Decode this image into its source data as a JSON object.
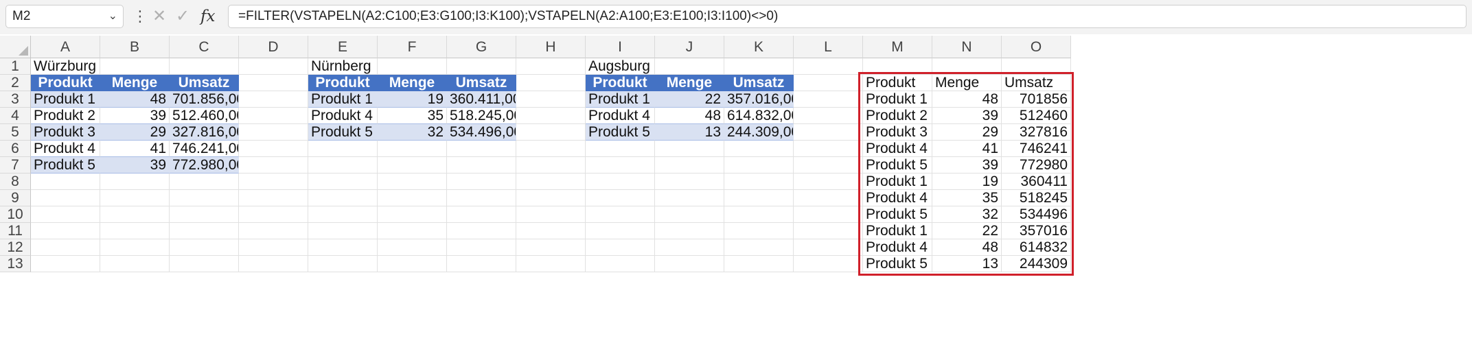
{
  "formula_bar": {
    "name_box": "M2",
    "formula": "=FILTER(VSTAPELN(A2:C100;E3:G100;I3:K100);VSTAPELN(A2:A100;E3:E100;I3:I100)<>0)"
  },
  "columns": [
    "A",
    "B",
    "C",
    "D",
    "E",
    "F",
    "G",
    "H",
    "I",
    "J",
    "K",
    "L",
    "M",
    "N",
    "O"
  ],
  "rows": [
    "1",
    "2",
    "3",
    "4",
    "5",
    "6",
    "7",
    "8",
    "9",
    "10",
    "11",
    "12",
    "13"
  ],
  "wuerzburg": {
    "title": "Würzburg",
    "headers": [
      "Produkt",
      "Menge",
      "Umsatz"
    ],
    "rows": [
      [
        "Produkt 1",
        "48",
        "701.856,00"
      ],
      [
        "Produkt 2",
        "39",
        "512.460,00"
      ],
      [
        "Produkt 3",
        "29",
        "327.816,00"
      ],
      [
        "Produkt 4",
        "41",
        "746.241,00"
      ],
      [
        "Produkt 5",
        "39",
        "772.980,00"
      ]
    ]
  },
  "nuernberg": {
    "title": "Nürnberg",
    "headers": [
      "Produkt",
      "Menge",
      "Umsatz"
    ],
    "rows": [
      [
        "Produkt 1",
        "19",
        "360.411,00"
      ],
      [
        "Produkt 4",
        "35",
        "518.245,00"
      ],
      [
        "Produkt 5",
        "32",
        "534.496,00"
      ]
    ]
  },
  "augsburg": {
    "title": "Augsburg",
    "headers": [
      "Produkt",
      "Menge",
      "Umsatz"
    ],
    "rows": [
      [
        "Produkt 1",
        "22",
        "357.016,00"
      ],
      [
        "Produkt 4",
        "48",
        "614.832,00"
      ],
      [
        "Produkt 5",
        "13",
        "244.309,00"
      ]
    ]
  },
  "result": {
    "headers": [
      "Produkt",
      "Menge",
      "Umsatz"
    ],
    "rows": [
      [
        "Produkt 1",
        "48",
        "701856"
      ],
      [
        "Produkt 2",
        "39",
        "512460"
      ],
      [
        "Produkt 3",
        "29",
        "327816"
      ],
      [
        "Produkt 4",
        "41",
        "746241"
      ],
      [
        "Produkt 5",
        "39",
        "772980"
      ],
      [
        "Produkt 1",
        "19",
        "360411"
      ],
      [
        "Produkt 4",
        "35",
        "518245"
      ],
      [
        "Produkt 5",
        "32",
        "534496"
      ],
      [
        "Produkt 1",
        "22",
        "357016"
      ],
      [
        "Produkt 4",
        "48",
        "614832"
      ],
      [
        "Produkt 5",
        "13",
        "244309"
      ]
    ]
  },
  "colors": {
    "header_blue": "#4472c4",
    "band": "#d9e1f2",
    "selection_red": "#d0202a"
  }
}
